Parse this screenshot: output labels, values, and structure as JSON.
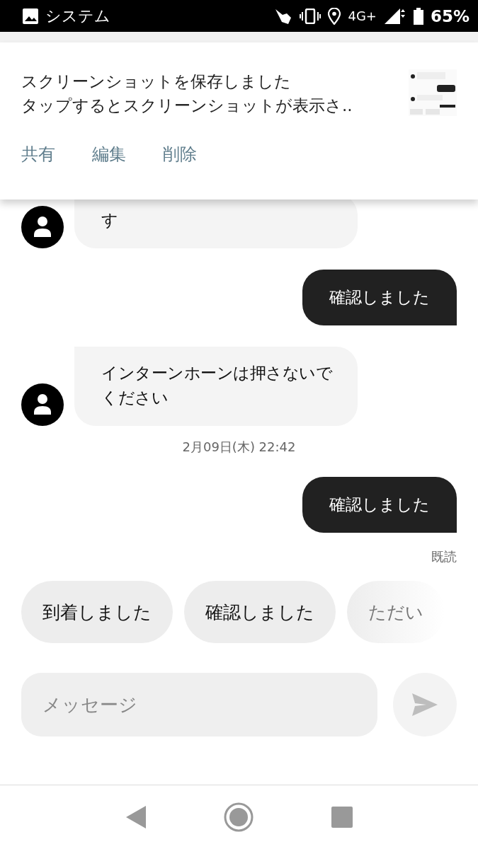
{
  "status_bar": {
    "app": "システム",
    "network": "4G+",
    "battery": "65%"
  },
  "notification": {
    "title": "スクリーンショットを保存しました",
    "body": "タップするとスクリーンショットが表示さ..",
    "actions": [
      "共有",
      "編集",
      "削除"
    ]
  },
  "messages": [
    {
      "kind": "received",
      "text": "す"
    },
    {
      "kind": "sent",
      "text": "確認しました"
    },
    {
      "kind": "received",
      "text": "インターンホーンは押さないでください"
    },
    {
      "kind": "timestamp",
      "text": "2月09日(木) 22:42"
    },
    {
      "kind": "sent",
      "text": "確認しました"
    },
    {
      "kind": "read",
      "text": "既読"
    }
  ],
  "quick_replies": [
    "到着しました",
    "確認しました",
    "ただい"
  ],
  "composer": {
    "placeholder": "メッセージ"
  }
}
